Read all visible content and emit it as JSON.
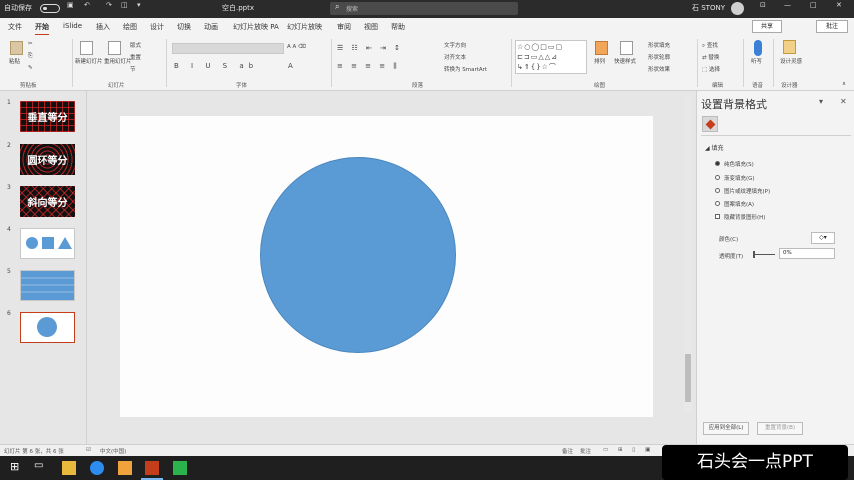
{
  "titlebar": {
    "autosave_label": "自动保存",
    "filename": "空白.pptx",
    "search_placeholder": "搜索",
    "user_name": "石 STONY"
  },
  "ribbon_tabs": [
    "文件",
    "开始",
    "iSlide",
    "插入",
    "绘图",
    "设计",
    "切换",
    "动画",
    "幻灯片放映 PA",
    "幻灯片放映",
    "审阅",
    "视图",
    "帮助"
  ],
  "active_tab": "开始",
  "share_label": "共享",
  "comment_label": "批注",
  "ribbon": {
    "paste": "粘贴",
    "new_slide": "新建幻灯片",
    "reuse": "重用幻灯片",
    "layout": "版式",
    "reset": "重置",
    "section": "节",
    "clipboard": "剪贴板",
    "slides": "幻灯片",
    "font": "字体",
    "paragraph": "段落",
    "text_direction": "文字方向",
    "align_text": "对齐文本",
    "smartart": "转换为 SmartArt",
    "drawing": "绘图",
    "arrange": "排列",
    "quick_styles": "快速样式",
    "shape_fill": "形状填充",
    "shape_outline": "形状轮廓",
    "shape_effects": "形状效果",
    "find": "查找",
    "replace": "替换",
    "select": "选择",
    "editing": "编辑",
    "dictate": "听写",
    "voice": "语音",
    "design_ideas": "设计灵感",
    "designer": "设计器"
  },
  "slides": [
    {
      "num": "1",
      "title": "垂直等分"
    },
    {
      "num": "2",
      "title": "圆环等分"
    },
    {
      "num": "3",
      "title": "斜向等分"
    },
    {
      "num": "4",
      "title": ""
    },
    {
      "num": "5",
      "title": ""
    },
    {
      "num": "6",
      "title": ""
    }
  ],
  "slide_colors": {
    "circle": "#5b9bd5",
    "accent": "#c43e1c"
  },
  "pane": {
    "title": "设置背景格式",
    "section": "填充",
    "options": [
      "纯色填充(S)",
      "渐变填充(G)",
      "图片或纹理填充(P)",
      "图案填充(A)",
      "隐藏背景图形(H)"
    ],
    "color_label": "颜色(C)",
    "transparency_label": "透明度(T)",
    "transparency_value": "0%",
    "apply_all": "应用到全部(L)",
    "reset_bg": "重置背景(B)"
  },
  "status": {
    "slide_info": "幻灯片 第 6 张，共 6 张",
    "language": "中文(中国)",
    "notes": "备注",
    "comments": "批注"
  },
  "watermark": "石头会一点PPT"
}
